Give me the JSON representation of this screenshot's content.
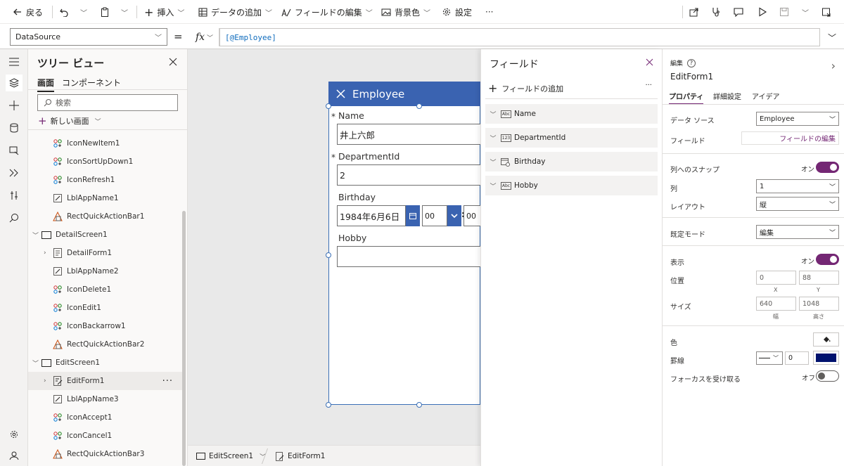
{
  "toolbar": {
    "back": "戻る",
    "insert": "挿入",
    "add_data": "データの追加",
    "edit_fields": "フィールドの編集",
    "background": "背景色",
    "settings": "設定",
    "more": "···"
  },
  "formula": {
    "property": "DataSource",
    "equals": "=",
    "fx": "fx",
    "value": "[@Employee]"
  },
  "tree": {
    "title": "ツリー ビュー",
    "tab_screens": "画面",
    "tab_components": "コンポーネント",
    "search_placeholder": "検索",
    "new_screen": "新しい画面",
    "items": [
      {
        "label": "IconNewItem1",
        "type": "icon"
      },
      {
        "label": "IconSortUpDown1",
        "type": "icon"
      },
      {
        "label": "IconRefresh1",
        "type": "icon"
      },
      {
        "label": "LblAppName1",
        "type": "label"
      },
      {
        "label": "RectQuickActionBar1",
        "type": "rect"
      },
      {
        "label": "DetailScreen1",
        "type": "screen"
      },
      {
        "label": "DetailForm1",
        "type": "form"
      },
      {
        "label": "LblAppName2",
        "type": "label"
      },
      {
        "label": "IconDelete1",
        "type": "icon"
      },
      {
        "label": "IconEdit1",
        "type": "icon"
      },
      {
        "label": "IconBackarrow1",
        "type": "icon"
      },
      {
        "label": "RectQuickActionBar2",
        "type": "rect"
      },
      {
        "label": "EditScreen1",
        "type": "screen"
      },
      {
        "label": "EditForm1",
        "type": "form"
      },
      {
        "label": "LblAppName3",
        "type": "label"
      },
      {
        "label": "IconAccept1",
        "type": "icon"
      },
      {
        "label": "IconCancel1",
        "type": "icon"
      },
      {
        "label": "RectQuickActionBar3",
        "type": "rect"
      }
    ]
  },
  "form": {
    "title": "Employee",
    "fields": [
      {
        "label": "Name",
        "value": "井上六郎",
        "required": "*"
      },
      {
        "label": "DepartmentId",
        "value": "2",
        "required": "*"
      },
      {
        "label": "Birthday",
        "value": "1984年6月6日",
        "hour": "00",
        "minute": "00"
      },
      {
        "label": "Hobby",
        "value": ""
      }
    ]
  },
  "bottombar": {
    "screen": "EditScreen1",
    "control": "EditForm1"
  },
  "fields_panel": {
    "title": "フィールド",
    "add_field": "フィールドの追加",
    "more": "···",
    "items": [
      {
        "label": "Name",
        "type_badge": "Abc"
      },
      {
        "label": "DepartmentId",
        "type_badge": "123"
      },
      {
        "label": "Birthday",
        "type_badge": ""
      },
      {
        "label": "Hobby",
        "type_badge": "Abc"
      }
    ]
  },
  "props": {
    "section": "編集",
    "control_name": "EditForm1",
    "tabs": [
      "プロパティ",
      "詳細設定",
      "アイデア"
    ],
    "datasource_label": "データ ソース",
    "datasource_value": "Employee",
    "fields_label": "フィールド",
    "fields_button": "フィールドの編集",
    "snap_label": "列へのスナップ",
    "snap_state": "オン",
    "columns_label": "列",
    "columns_value": "1",
    "layout_label": "レイアウト",
    "layout_value": "縦",
    "mode_label": "既定モード",
    "mode_value": "編集",
    "visible_label": "表示",
    "visible_state": "オン",
    "position_label": "位置",
    "pos_x": "0",
    "pos_y": "88",
    "x_label": "X",
    "y_label": "Y",
    "size_label": "サイズ",
    "width": "640",
    "height": "1048",
    "width_label": "幅",
    "height_label": "高さ",
    "color_label": "色",
    "border_label": "罫線",
    "border_width": "0",
    "border_color": "#00126e",
    "focus_label": "フォーカスを受け取る",
    "focus_state": "オフ",
    "accent": "#742774"
  }
}
